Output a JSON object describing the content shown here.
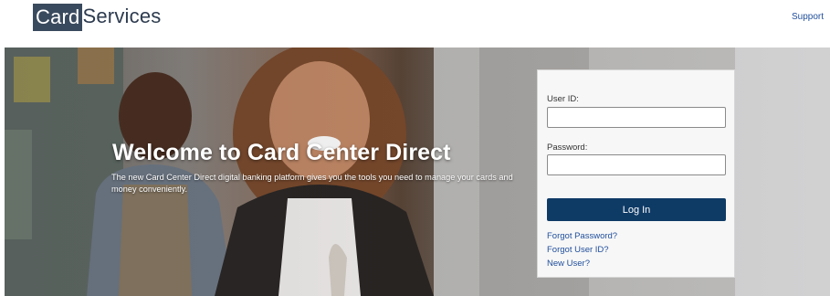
{
  "header": {
    "logo_box_text": "Card",
    "logo_text": "Services",
    "support_label": "Support"
  },
  "hero": {
    "title": "Welcome to Card Center Direct",
    "subtitle": "The new Card Center Direct digital banking platform gives you the tools you need to manage your cards and money conveniently."
  },
  "login": {
    "user_id_label": "User ID:",
    "user_id_value": "",
    "password_label": "Password:",
    "password_value": "",
    "login_button": "Log In",
    "forgot_password": "Forgot Password?",
    "forgot_user_id": "Forgot User ID?",
    "new_user": "New User?"
  },
  "colors": {
    "primary_button": "#0e3a66",
    "link": "#1f4e9c",
    "logo_box": "#3a4a5e"
  }
}
